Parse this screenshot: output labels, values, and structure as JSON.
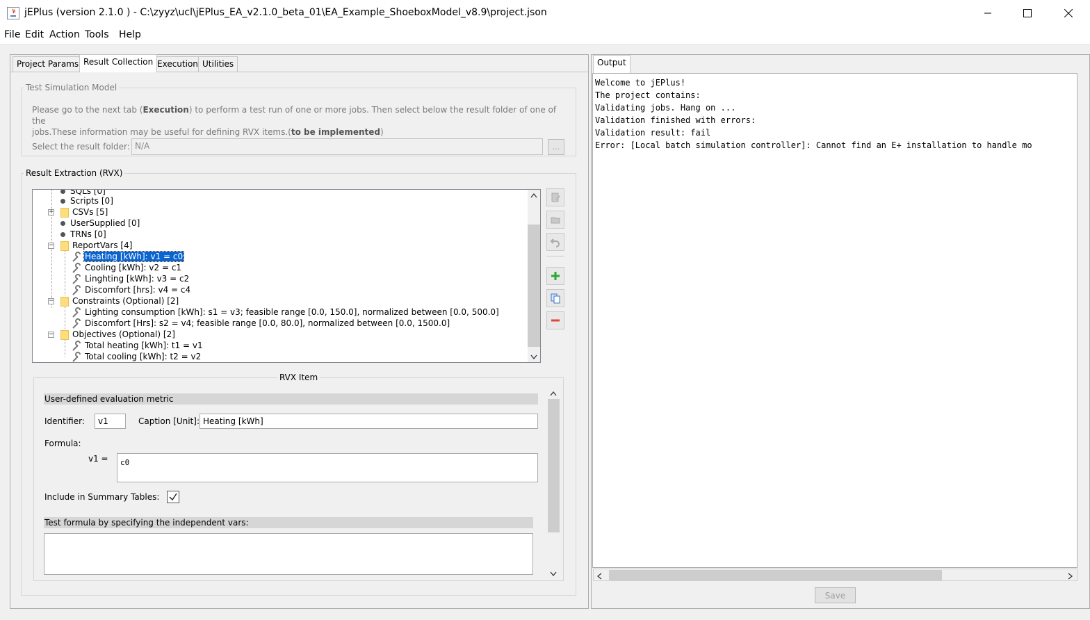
{
  "window": {
    "title": "jEPlus (version 2.1.0 )  - C:\\zyyz\\ucl\\jEPlus_EA_v2.1.0_beta_01\\EA_Example_ShoeboxModel_v8.9\\project.json",
    "minimize_icon": "minimize-icon",
    "maximize_icon": "maximize-icon",
    "close_icon": "close-icon"
  },
  "menu": [
    "File",
    "Edit",
    "Action",
    "Tools",
    "Help"
  ],
  "left_tabs": [
    "Project Params",
    "Result Collection",
    "Execution",
    "Utilities"
  ],
  "active_left_tab": "Result Collection",
  "test_model": {
    "title": "Test Simulation Model",
    "desc_part1": "Please go to the next tab (",
    "desc_bold1": "Execution",
    "desc_part2": ") to perform a test run of one or more jobs. Then select below the result folder of one of the",
    "desc_part3": "jobs.These information may be useful for defining RVX items.(",
    "desc_bold2": "to be implemented",
    "desc_part4": ")",
    "folder_label": "Select the result folder:",
    "folder_value": "N/A",
    "browse_label": "..."
  },
  "rvx": {
    "title": "Result Extraction (RVX)",
    "tree": [
      {
        "label": "SQLs [0]",
        "kind": "leaf-dot",
        "level": 1
      },
      {
        "label": "Scripts [0]",
        "kind": "leaf-dot",
        "level": 1
      },
      {
        "label": "CSVs [5]",
        "kind": "folder",
        "level": 1,
        "expander": "+"
      },
      {
        "label": "UserSupplied [0]",
        "kind": "leaf-dot",
        "level": 1
      },
      {
        "label": "TRNs [0]",
        "kind": "leaf-dot",
        "level": 1
      },
      {
        "label": "ReportVars [4]",
        "kind": "folder",
        "level": 1,
        "expander": "-"
      },
      {
        "label": "Heating [kWh]: v1 = c0",
        "kind": "item",
        "level": 2,
        "selected": true
      },
      {
        "label": "Cooling [kWh]: v2 = c1",
        "kind": "item",
        "level": 2
      },
      {
        "label": "Linghting [kWh]: v3 = c2",
        "kind": "item",
        "level": 2
      },
      {
        "label": "Discomfort [hrs]: v4 = c4",
        "kind": "item",
        "level": 2
      },
      {
        "label": "Constraints (Optional) [2]",
        "kind": "folder",
        "level": 1,
        "expander": "-"
      },
      {
        "label": "Lighting consumption [kWh]: s1 = v3; feasible range [0.0, 150.0], normalized between [0.0, 500.0]",
        "kind": "item",
        "level": 2
      },
      {
        "label": "Discomfort [Hrs]: s2 = v4; feasible range [0.0, 80.0], normalized between [0.0, 1500.0]",
        "kind": "item",
        "level": 2
      },
      {
        "label": "Objectives (Optional) [2]",
        "kind": "folder",
        "level": 1,
        "expander": "-"
      },
      {
        "label": "Total heating [kWh]: t1 = v1",
        "kind": "item",
        "level": 2
      },
      {
        "label": "Total cooling [kWh]: t2 = v2",
        "kind": "item",
        "level": 2
      }
    ],
    "side_buttons": [
      "edit-file-icon",
      "open-folder-icon",
      "undo-icon",
      "add-icon",
      "copy-icon",
      "remove-icon"
    ]
  },
  "rvx_item": {
    "title": "RVX Item",
    "section_title": "User-defined evaluation metric",
    "identifier_label": "Identifier:",
    "identifier_value": "v1",
    "caption_label": "Caption [Unit]:",
    "caption_value": "Heating [kWh]",
    "formula_label": "Formula:",
    "formula_lhs": "v1  =",
    "formula_value": "c0",
    "summary_label": "Include in Summary Tables:",
    "summary_checked": true,
    "test_title": "Test formula by specifying the independent vars:",
    "test_value": ""
  },
  "output": {
    "tab": "Output",
    "lines": [
      "Welcome to jEPlus!",
      "The project contains:",
      "Validating jobs. Hang on ...",
      "Validation finished with errors:",
      "Validation result: fail",
      "Error: [Local batch simulation controller]: Cannot find an E+ installation to handle mo"
    ],
    "save_label": "Save"
  }
}
